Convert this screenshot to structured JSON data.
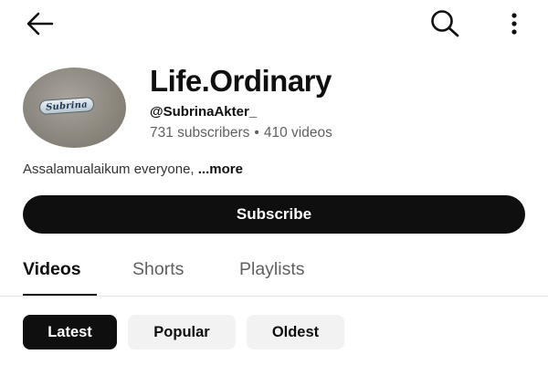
{
  "header": {
    "back_icon": "arrow-left-icon",
    "search_icon": "search-icon",
    "more_icon": "more-vertical-icon"
  },
  "channel": {
    "avatar_text": "Subrina",
    "title": "Life.Ordinary",
    "handle": "@SubrinaAkter_",
    "subscribers": "731 subscribers",
    "stat_separator": "•",
    "videos": "410 videos",
    "description": "Assalamualaikum everyone, ",
    "more_label": "...more",
    "subscribe_label": "Subscribe"
  },
  "tabs": [
    {
      "label": "Videos",
      "active": true
    },
    {
      "label": "Shorts",
      "active": false
    },
    {
      "label": "Playlists",
      "active": false
    }
  ],
  "filters": [
    {
      "label": "Latest",
      "selected": true
    },
    {
      "label": "Popular",
      "selected": false
    },
    {
      "label": "Oldest",
      "selected": false
    }
  ],
  "colors": {
    "primary": "#0f0f0f",
    "secondary_text": "#606060",
    "chip_background": "#f2f2f2"
  }
}
